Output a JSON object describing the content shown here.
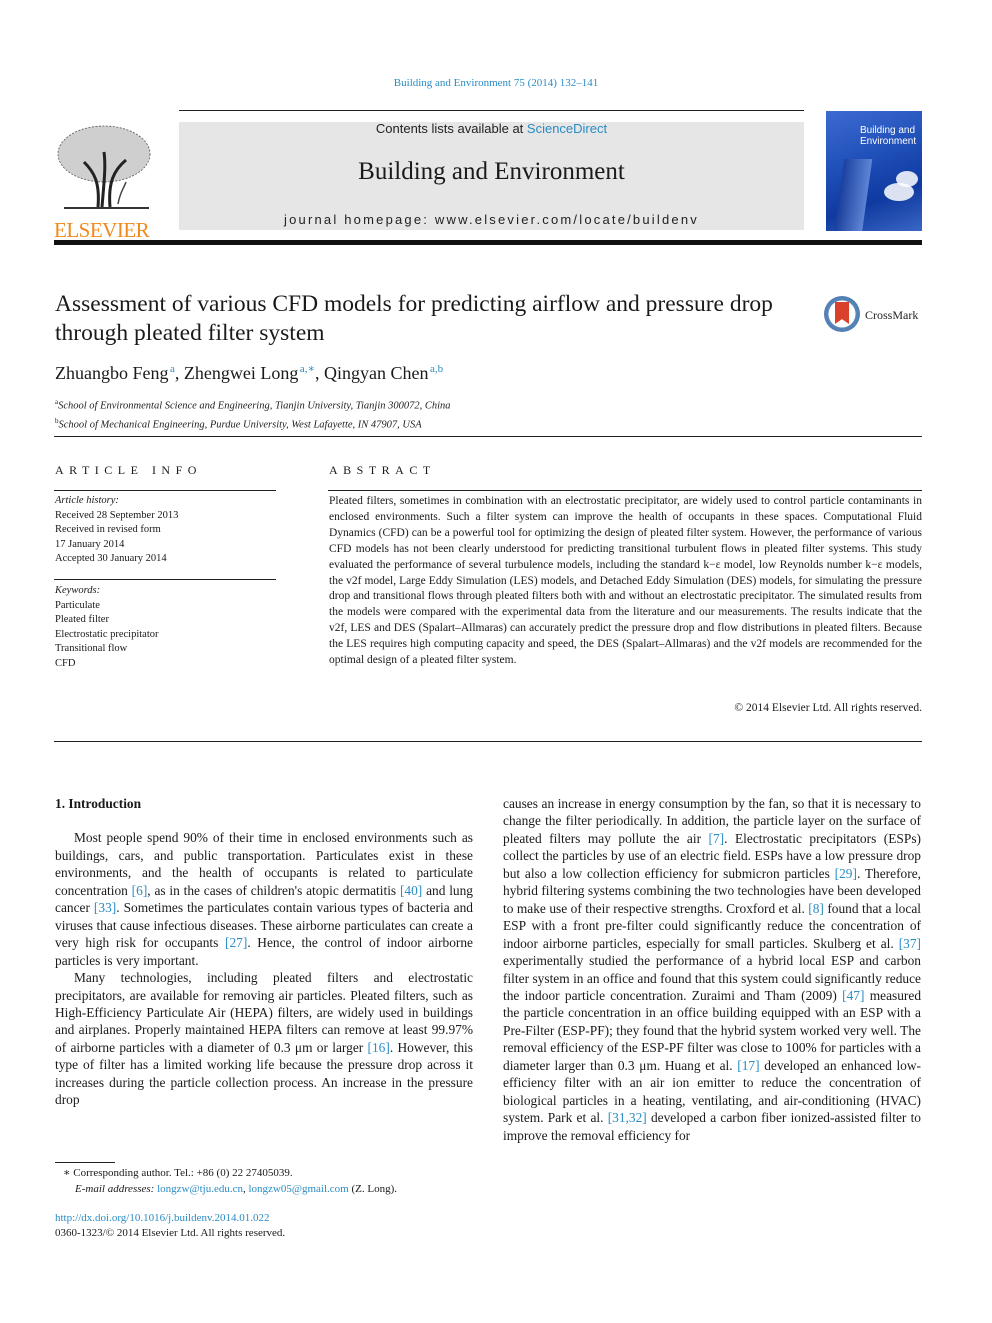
{
  "header": {
    "citation": "Building and Environment 75 (2014) 132–141",
    "contents_prefix": "Contents lists available at ",
    "contents_link": "ScienceDirect",
    "journal_name": "Building and Environment",
    "homepage": "journal homepage: www.elsevier.com/locate/buildenv",
    "publisher_logo_text": "ELSEVIER",
    "cover_title_line1": "Building and",
    "cover_title_line2": "Environment",
    "colors": {
      "link": "#2a8cc4",
      "elsevier_orange": "#f08a1c",
      "banner_gray": "#e6e6e6"
    }
  },
  "article": {
    "title": "Assessment of various CFD models for predicting airflow and pressure drop through pleated filter system",
    "crossmark_label": "CrossMark",
    "authors": [
      {
        "name": "Zhuangbo Feng",
        "sup": "a"
      },
      {
        "name": "Zhengwei Long",
        "sup": "a,∗"
      },
      {
        "name": "Qingyan Chen",
        "sup": "a,b"
      }
    ],
    "affiliations": [
      {
        "sup": "a",
        "text": "School of Environmental Science and Engineering, Tianjin University, Tianjin 300072, China"
      },
      {
        "sup": "b",
        "text": "School of Mechanical Engineering, Purdue University, West Lafayette, IN 47907, USA"
      }
    ]
  },
  "article_info": {
    "heading": "ARTICLE INFO",
    "history_label": "Article history:",
    "history": [
      "Received 28 September 2013",
      "Received in revised form",
      "17 January 2014",
      "Accepted 30 January 2014"
    ],
    "keywords_label": "Keywords:",
    "keywords": [
      "Particulate",
      "Pleated filter",
      "Electrostatic precipitator",
      "Transitional flow",
      "CFD"
    ]
  },
  "abstract": {
    "heading": "ABSTRACT",
    "text": "Pleated filters, sometimes in combination with an electrostatic precipitator, are widely used to control particle contaminants in enclosed environments. Such a filter system can improve the health of occupants in these spaces. Computational Fluid Dynamics (CFD) can be a powerful tool for optimizing the design of pleated filter system. However, the performance of various CFD models has not been clearly understood for predicting transitional turbulent flows in pleated filter systems. This study evaluated the performance of several turbulence models, including the standard k−ε model, low Reynolds number k−ε models, the v2f model, Large Eddy Simulation (LES) models, and Detached Eddy Simulation (DES) models, for simulating the pressure drop and transitional flows through pleated filters both with and without an electrostatic precipitator. The simulated results from the models were compared with the experimental data from the literature and our measurements. The results indicate that the v2f, LES and DES (Spalart–Allmaras) can accurately predict the pressure drop and flow distributions in pleated filters. Because the LES requires high computing capacity and speed, the DES (Spalart–Allmaras) and the v2f models are recommended for the optimal design of a pleated filter system.",
    "copyright": "© 2014 Elsevier Ltd. All rights reserved."
  },
  "body": {
    "section_title": "1.  Introduction",
    "left": {
      "p1": [
        "Most people spend 90% of their time in enclosed environments such as buildings, cars, and public transportation. Particulates exist in these environments, and the health of occupants is related to particulate concentration ",
        "[6]",
        ", as in the cases of children's atopic dermatitis ",
        "[40]",
        " and lung cancer ",
        "[33]",
        ". Sometimes the particulates contain various types of bacteria and viruses that cause infectious diseases. These airborne particulates can create a very high risk for occupants ",
        "[27]",
        ". Hence, the control of indoor airborne particles is very important."
      ],
      "p2": [
        "Many technologies, including pleated filters and electrostatic precipitators, are available for removing air particles. Pleated filters, such as High-Efficiency Particulate Air (HEPA) filters, are widely used in buildings and airplanes. Properly maintained HEPA filters can remove at least 99.97% of airborne particles with a diameter of 0.3 μm or larger ",
        "[16]",
        ". However, this type of filter has a limited working life because the pressure drop across it increases during the particle collection process. An increase in the pressure drop"
      ]
    },
    "right": {
      "p1": [
        "causes an increase in energy consumption by the fan, so that it is necessary to change the filter periodically. In addition, the particle layer on the surface of pleated filters may pollute the air ",
        "[7]",
        ". Electrostatic precipitators (ESPs) collect the particles by use of an electric field. ESPs have a low pressure drop but also a low collection efficiency for submicron particles ",
        "[29]",
        ". Therefore, hybrid filtering systems combining the two technologies have been developed to make use of their respective strengths. Croxford et al. ",
        "[8]",
        " found that a local ESP with a front pre-filter could significantly reduce the concentration of indoor airborne particles, especially for small particles. Skulberg et al. ",
        "[37]",
        " experimentally studied the performance of a hybrid local ESP and carbon filter system in an office and found that this system could significantly reduce the indoor particle concentration. Zuraimi and Tham (2009) ",
        "[47]",
        " measured the particle concentration in an office building equipped with an ESP with a Pre-Filter (ESP-PF); they found that the hybrid system worked very well. The removal efficiency of the ESP-PF filter was close to 100% for particles with a diameter larger than 0.3 μm. Huang et al. ",
        "[17]",
        " developed an enhanced low-efficiency filter with an air ion emitter to reduce the concentration of biological particles in a heating, ventilating, and air-conditioning (HVAC) system. Park et al. ",
        "[31,32]",
        " developed a carbon fiber ionized-assisted filter to improve the removal efficiency for"
      ]
    }
  },
  "footnotes": {
    "corresponding": "∗  Corresponding author. Tel.: +86 (0) 22 27405039.",
    "email_label": "E-mail addresses:",
    "email1": "longzw@tju.edu.cn",
    "email2": "longzw05@gmail.com",
    "email_suffix": " (Z. Long).",
    "doi": "http://dx.doi.org/10.1016/j.buildenv.2014.01.022",
    "issn": "0360-1323/© 2014 Elsevier Ltd. All rights reserved."
  }
}
